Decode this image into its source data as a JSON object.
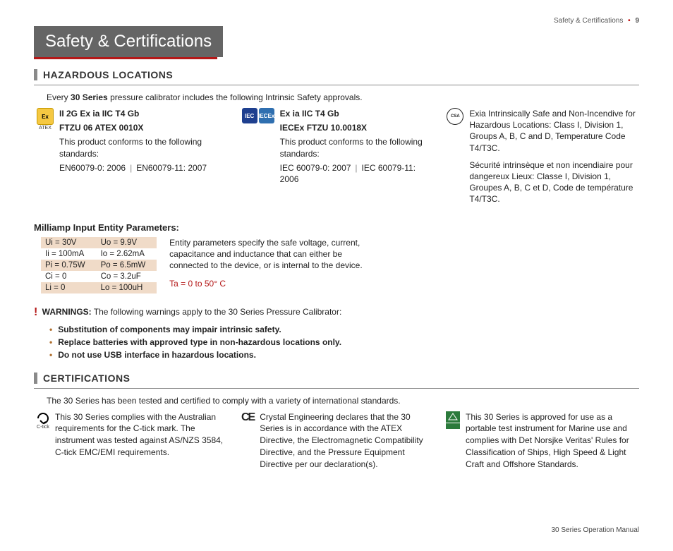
{
  "page_header": {
    "section": "Safety & Certifications",
    "page": "9"
  },
  "banner": "Safety & Certifications",
  "hazardous": {
    "heading": "HAZARDOUS LOCATIONS",
    "intro_pre": "Every ",
    "intro_bold": "30 Series",
    "intro_post": " pressure calibrator includes the following Intrinsic Safety approvals.",
    "atex": {
      "line1": "II 2G Ex ia IIC T4 Gb",
      "line2": "FTZU 06 ATEX 0010X",
      "conform": "This product conforms to the following standards:",
      "std1": "EN60079-0: 2006",
      "std2": "EN60079-11: 2007"
    },
    "iec": {
      "line1": "Ex ia IIC T4 Gb",
      "line2": "IECEx FTZU 10.0018X",
      "conform": "This product conforms to the following standards:",
      "std1": "IEC 60079-0: 2007",
      "std2": "IEC 60079-11: 2006"
    },
    "csa": {
      "para1": "Exia Intrinsically Safe and Non-Incendive for Hazardous Locations: Class I, Division 1, Groups A, B, C and D, Temperature Code T4/T3C.",
      "para2": "Sécurité intrinsèque et non incendiaire pour dangereux Lieux: Classe I, Division 1, Groupes A, B, C et D, Code de température T4/T3C."
    }
  },
  "entity": {
    "heading": "Milliamp Input Entity Parameters:",
    "rows": [
      {
        "a": "Ui = 30V",
        "b": "Uo = 9.9V"
      },
      {
        "a": "Ii = 100mA",
        "b": "Io = 2.62mA"
      },
      {
        "a": "Pi = 0.75W",
        "b": "Po = 6.5mW"
      },
      {
        "a": "Ci = 0",
        "b": "Co = 3.2uF"
      },
      {
        "a": "Li = 0",
        "b": "Lo = 100uH"
      }
    ],
    "desc": "Entity parameters specify the safe voltage, current, capacitance and inductance that can either be connected to the device, or is internal to the device.",
    "ta": "Ta = 0 to 50° C"
  },
  "warnings": {
    "label": "WARNINGS:",
    "intro": "The following warnings apply to the 30 Series Pressure Calibrator:",
    "items": [
      "Substitution of components may impair intrinsic safety.",
      "Replace batteries with approved type in non-hazardous locations only.",
      "Do not use USB interface in hazardous locations."
    ]
  },
  "certs": {
    "heading": "CERTIFICATIONS",
    "intro": "The 30 Series has been tested and certified to comply with a variety of international standards.",
    "ctick": "This 30 Series complies with the Australian requirements for the C-tick mark. The instrument was tested against AS/NZS 3584, C-tick EMC/EMI requirements.",
    "ce": "Crystal Engineering declares that the 30 Series is in accordance with the ATEX Directive, the Electromagnetic Compatibility Directive, and the Pressure Equipment Directive per our declaration(s).",
    "dnv": "This 30 Series is approved for use as a portable test instrument for Marine use and complies with Det Norsjke Veritas' Rules for Classification of Ships, High Speed & Light Craft and Offshore Standards."
  },
  "footer": "30 Series Operation Manual"
}
